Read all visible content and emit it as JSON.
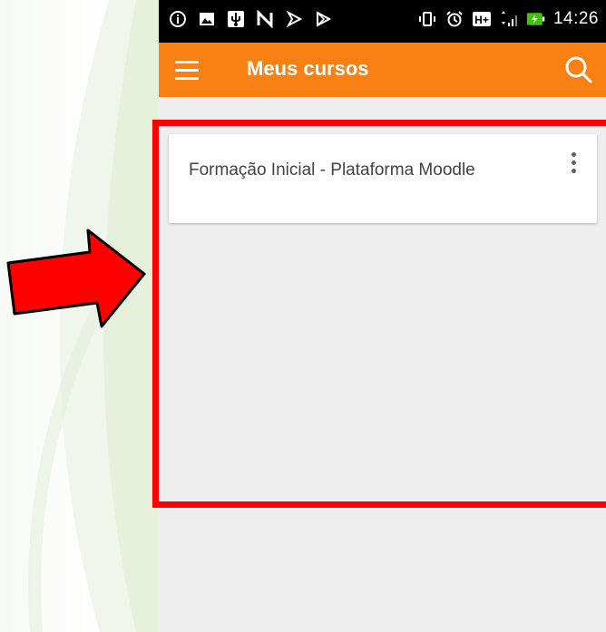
{
  "status_bar": {
    "time": "14:26",
    "left_icons": [
      "info-icon",
      "image-icon",
      "usb-icon",
      "nfc-icon",
      "cast-icon",
      "play-store-icon"
    ],
    "right_icons": [
      "vibrate-icon",
      "alarm-icon",
      "network-h-plus-icon",
      "signal-icon",
      "battery-charging-icon"
    ],
    "network_label": "H+"
  },
  "app_bar": {
    "title": "Meus cursos",
    "color": "#f98012"
  },
  "courses": [
    {
      "name": "Formação Inicial - Plataforma Moodle"
    }
  ],
  "colors": {
    "background": "#eeeeee",
    "card": "#ffffff",
    "annotation": "#ff0000"
  }
}
